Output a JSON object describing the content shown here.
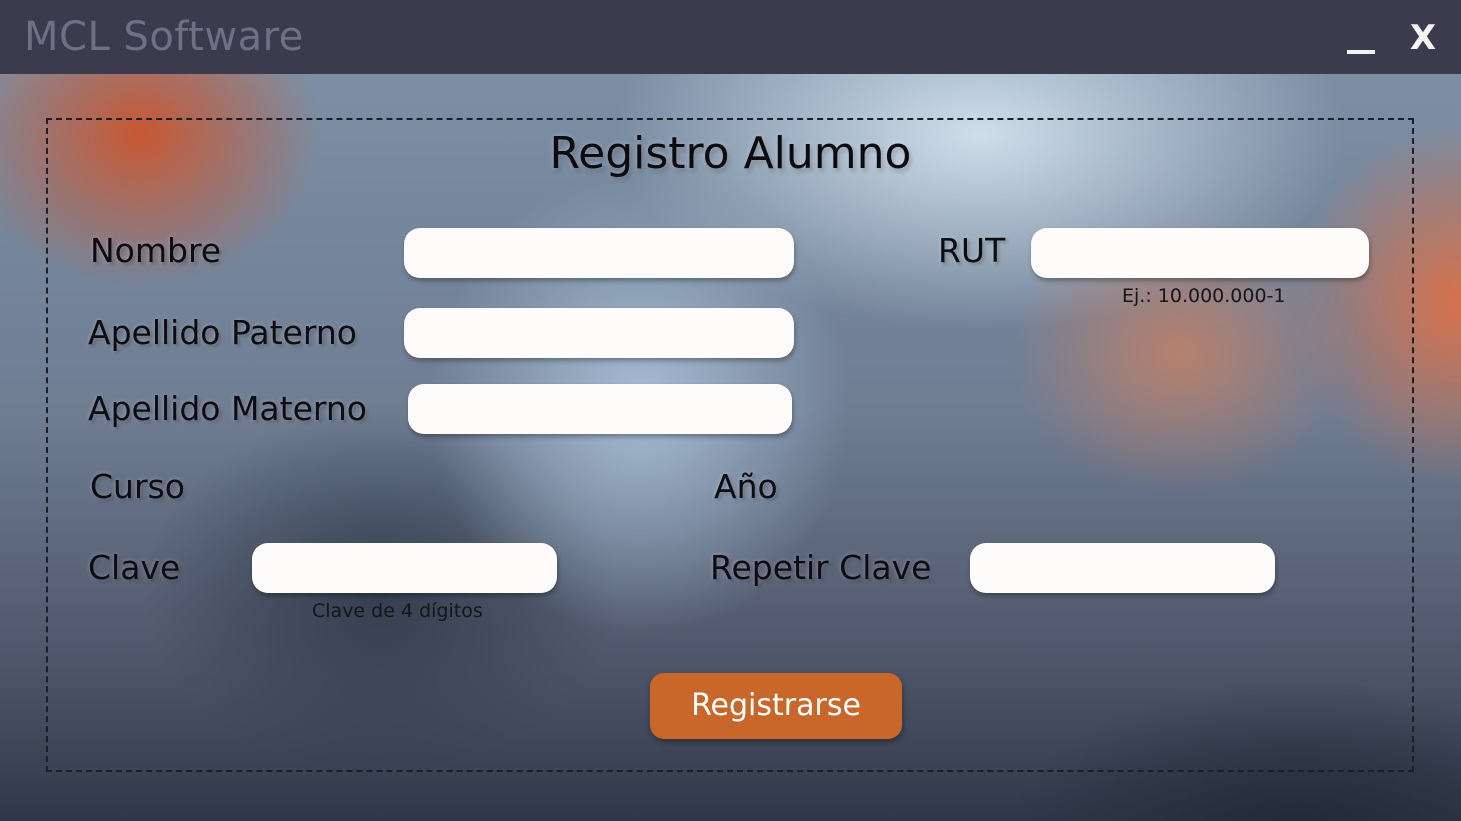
{
  "titlebar": {
    "app_name": "MCL Software",
    "minimize_label": "_",
    "close_label": "X"
  },
  "form": {
    "title": "Registro Alumno",
    "fields": {
      "nombre": {
        "label": "Nombre",
        "value": ""
      },
      "rut": {
        "label": "RUT",
        "value": "",
        "hint": "Ej.: 10.000.000-1"
      },
      "apellido_paterno": {
        "label": "Apellido Paterno",
        "value": ""
      },
      "apellido_materno": {
        "label": "Apellido Materno",
        "value": ""
      },
      "curso": {
        "label": "Curso"
      },
      "anio": {
        "label": "Año"
      },
      "clave": {
        "label": "Clave",
        "value": "",
        "hint": "Clave de 4 dígitos"
      },
      "repetir_clave": {
        "label": "Repetir Clave",
        "value": ""
      }
    },
    "submit_label": "Registrarse"
  },
  "colors": {
    "titlebar_bg": "#3c3a4d",
    "title_text": "#6f6f85",
    "accent_button": "#c9672a",
    "input_bg": "#fdfcfa"
  },
  "icons": {
    "minimize": "minimize-icon",
    "close": "close-icon"
  }
}
